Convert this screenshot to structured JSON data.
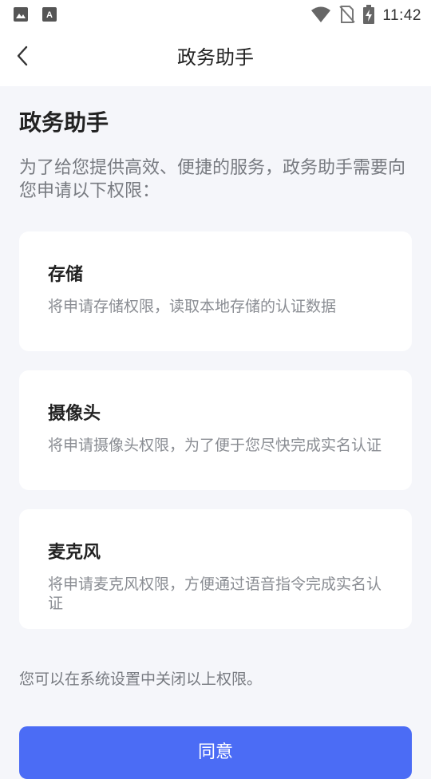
{
  "status_bar": {
    "time": "11:42",
    "icons": [
      "image-icon",
      "text-a-icon",
      "wifi-icon",
      "no-sim-icon",
      "battery-charging-icon"
    ]
  },
  "nav": {
    "title": "政务助手",
    "back_icon": "chevron-left-icon"
  },
  "main": {
    "heading": "政务助手",
    "intro": "为了给您提供高效、便捷的服务，政务助手需要向您申请以下权限：",
    "permissions": [
      {
        "title": "存储",
        "desc": "将申请存储权限，读取本地存储的认证数据"
      },
      {
        "title": "摄像头",
        "desc": "将申请摄像头权限，为了便于您尽快完成实名认证"
      },
      {
        "title": "麦克风",
        "desc": "将申请麦克风权限，方便通过语音指令完成实名认证"
      }
    ],
    "footer_note": "您可以在系统设置中关闭以上权限。",
    "agree_label": "同意"
  },
  "colors": {
    "accent": "#4b6cf5",
    "background": "#f5f6fa",
    "card": "#ffffff"
  }
}
